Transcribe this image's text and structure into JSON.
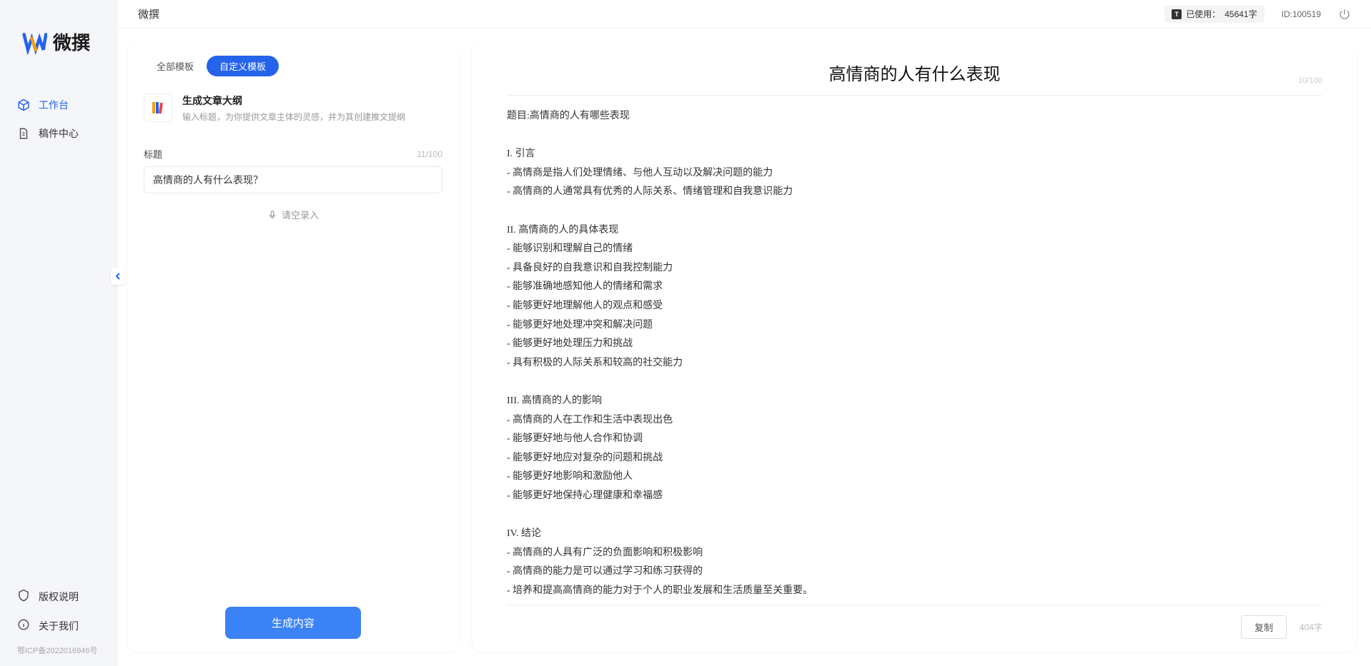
{
  "app": {
    "name": "微撰",
    "header_title": "微撰"
  },
  "sidebar": {
    "nav": [
      {
        "label": "工作台",
        "icon": "workspace",
        "active": true
      },
      {
        "label": "稿件中心",
        "icon": "drafts",
        "active": false
      }
    ],
    "footer": [
      {
        "label": "版权说明",
        "icon": "copyright"
      },
      {
        "label": "关于我们",
        "icon": "about"
      }
    ],
    "icp": "鄂ICP备2022016946号"
  },
  "header": {
    "usage_prefix": "已使用：",
    "usage_value": "45641字",
    "user_id": "ID:100519"
  },
  "left": {
    "tabs": [
      {
        "label": "全部模板",
        "active": false
      },
      {
        "label": "自定义模板",
        "active": true
      }
    ],
    "template": {
      "name": "生成文章大纲",
      "desc": "输入标题，为你提供文章主体的灵感，并为其创建推文提纲"
    },
    "form": {
      "title_label": "标题",
      "title_count": "11/100",
      "title_value": "高情商的人有什么表现？",
      "voice_label": "请空录入"
    },
    "generate_btn": "生成内容"
  },
  "output": {
    "title": "高情商的人有什么表现",
    "title_count": "10/100",
    "body": "题目:高情商的人有哪些表现\n\nI. 引言\n- 高情商是指人们处理情绪、与他人互动以及解决问题的能力\n- 高情商的人通常具有优秀的人际关系、情绪管理和自我意识能力\n\nII. 高情商的人的具体表现\n- 能够识别和理解自己的情绪\n- 具备良好的自我意识和自我控制能力\n- 能够准确地感知他人的情绪和需求\n- 能够更好地理解他人的观点和感受\n- 能够更好地处理冲突和解决问题\n- 能够更好地处理压力和挑战\n- 具有积极的人际关系和较高的社交能力\n\nIII. 高情商的人的影响\n- 高情商的人在工作和生活中表现出色\n- 能够更好地与他人合作和协调\n- 能够更好地应对复杂的问题和挑战\n- 能够更好地影响和激励他人\n- 能够更好地保持心理健康和幸福感\n\nIV. 结论\n- 高情商的人具有广泛的负面影响和积极影响\n- 高情商的能力是可以通过学习和练习获得的\n- 培养和提高高情商的能力对于个人的职业发展和生活质量至关重要。",
    "copy_btn": "复制",
    "word_count": "404字"
  }
}
